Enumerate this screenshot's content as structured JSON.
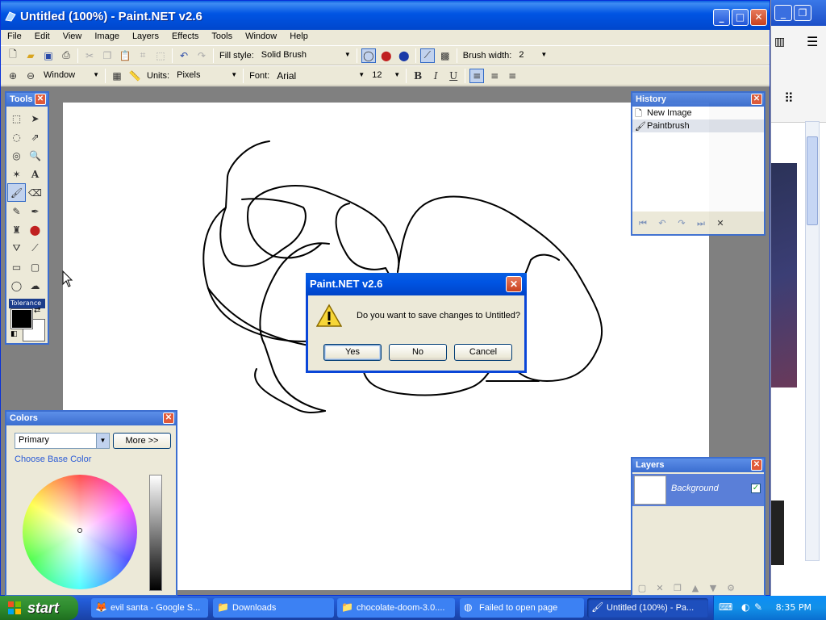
{
  "window": {
    "title": "Untitled (100%) - Paint.NET v2.6"
  },
  "menu": [
    "File",
    "Edit",
    "View",
    "Image",
    "Layers",
    "Effects",
    "Tools",
    "Window",
    "Help"
  ],
  "toolbar1": {
    "fill_style_label": "Fill style:",
    "fill_style_value": "Solid Brush",
    "brush_width_label": "Brush width:",
    "brush_width_value": "2"
  },
  "toolbar2": {
    "zoom_value": "Window",
    "units_label": "Units:",
    "units_value": "Pixels",
    "font_label": "Font:",
    "font_value": "Arial",
    "font_size": "12",
    "bold": "B",
    "italic": "I",
    "underline": "U"
  },
  "tools_panel": {
    "title": "Tools",
    "tolerance_label": "Tolerance"
  },
  "history_panel": {
    "title": "History",
    "items": [
      "New Image",
      "Paintbrush"
    ]
  },
  "colors_panel": {
    "title": "Colors",
    "select_value": "Primary",
    "more_button": "More >>",
    "choose_link": "Choose Base Color"
  },
  "layers_panel": {
    "title": "Layers",
    "layer_name": "Background"
  },
  "dialog": {
    "title": "Paint.NET v2.6",
    "message": "Do you want to save changes to Untitled?",
    "yes": "Yes",
    "no": "No",
    "cancel": "Cancel"
  },
  "taskbar": {
    "start": "start",
    "tasks": [
      "evil santa - Google S...",
      "Downloads",
      "chocolate-doom-3.0....",
      "Failed to open page",
      "Untitled (100%) - Pa..."
    ],
    "clock": "8:35 PM"
  },
  "colors": {
    "title_blue": "#0054e3",
    "panel_border": "#3c6ed0",
    "taskbar_blue": "#245edb",
    "start_green": "#2e8b2e"
  }
}
